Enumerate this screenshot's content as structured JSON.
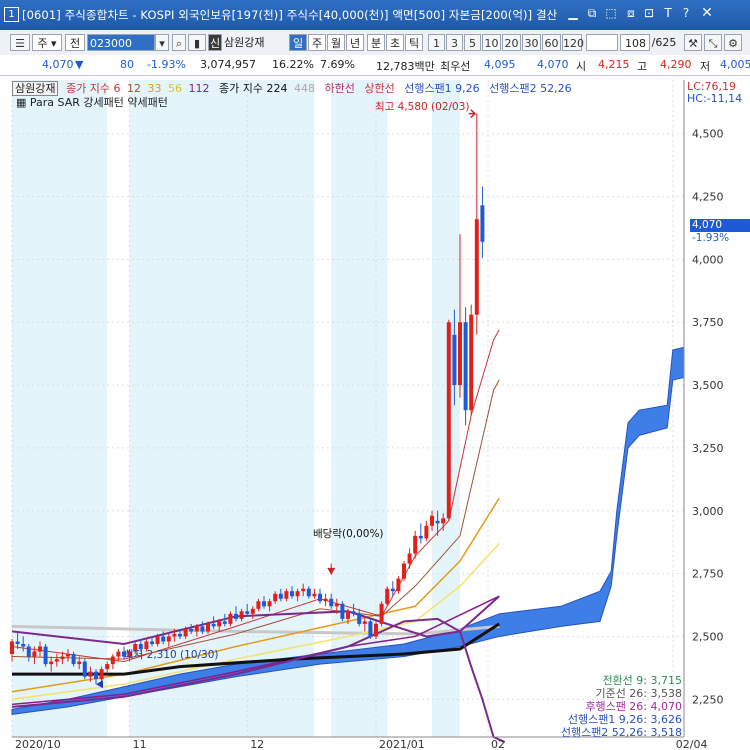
{
  "window": {
    "number": "1",
    "title": "[0601] 주식종합차트 - KOSPI 외국인보유[197(천)] 주식수[40,000(천)] 액면[500] 자본금[200(억)] 결산",
    "controls": [
      "min-icon",
      "restore-icon",
      "max-icon",
      "settings-icon",
      "lock-icon",
      "text-icon",
      "help-icon",
      "close-icon"
    ]
  },
  "toolbar": {
    "market": "주",
    "jeon": "전",
    "code": "023000",
    "badge": "신",
    "stock_name": "삼원강재",
    "periods": [
      "일",
      "주",
      "월",
      "년",
      "분",
      "초",
      "틱"
    ],
    "active_period": "일",
    "intervals": [
      "1",
      "3",
      "5",
      "10",
      "20",
      "30",
      "60",
      "120"
    ],
    "count": "108",
    "total": "/625"
  },
  "info": {
    "price": "4,070",
    "dir": "▼",
    "change": "80",
    "change_pct": "-1.93%",
    "volume": "3,074,957",
    "vol_pct": "16.22%",
    "turnover": "7.69%",
    "amount": "12,783백만",
    "best_ask_label": "최우선",
    "best_ask": "4,095",
    "best_bid": "4,070",
    "open_label": "시",
    "open": "4,215",
    "high_label": "고",
    "high": "4,290",
    "low_label": "저",
    "low": "4,005"
  },
  "legend": {
    "stock": "삼원강재",
    "ma_label": "종가 지수",
    "ma_periods": [
      "6",
      "12",
      "33",
      "56",
      "112"
    ],
    "vol_label": "종가 지수",
    "vol_periods": [
      "224",
      "448"
    ],
    "low_limit": "하한선",
    "high_limit": "상한선",
    "span1": "선행스팬1 9,26",
    "span2": "선행스팬2 52,26",
    "sar": "Para SAR 강세패턴  약세패턴",
    "lc": "LC:76,19",
    "hc": "HC:-11,14"
  },
  "annotations": {
    "high": "최고 4,580 (02/03)",
    "dividend": "배당락(0,00%)",
    "low": "최저 2,310 (10/30)",
    "current_price": "4,070",
    "current_pct": "-1.93%"
  },
  "ichimoku": [
    {
      "text": "전환선 9: 3,715",
      "color": "#2e8b57"
    },
    {
      "text": "기준선 26: 3,538",
      "color": "#555555"
    },
    {
      "text": "후행스팬 26: 4,070",
      "color": "#9b2d9b"
    },
    {
      "text": "선행스팬1 9,26: 3,626",
      "color": "#2a52be"
    },
    {
      "text": "선행스팬2 52,26: 3,518",
      "color": "#2a52be"
    }
  ],
  "chart_data": {
    "type": "candlestick",
    "ylim": [
      2100,
      4650
    ],
    "y_ticks": [
      2250,
      2500,
      2750,
      3000,
      3250,
      3500,
      3750,
      4000,
      4250,
      4500
    ],
    "x_labels": [
      {
        "label": "2020/10",
        "index": 0
      },
      {
        "label": "11",
        "index": 21
      },
      {
        "label": "12",
        "index": 42
      },
      {
        "label": "2021/01",
        "index": 65
      },
      {
        "label": "02",
        "index": 85
      },
      {
        "label": "02/04",
        "index": 118
      }
    ],
    "candles": [
      [
        2430,
        2490,
        2400,
        2480
      ],
      [
        2480,
        2520,
        2450,
        2470
      ],
      [
        2470,
        2500,
        2440,
        2460
      ],
      [
        2460,
        2470,
        2400,
        2420
      ],
      [
        2420,
        2460,
        2390,
        2440
      ],
      [
        2440,
        2480,
        2420,
        2460
      ],
      [
        2460,
        2470,
        2380,
        2390
      ],
      [
        2390,
        2420,
        2360,
        2400
      ],
      [
        2400,
        2430,
        2380,
        2410
      ],
      [
        2410,
        2440,
        2390,
        2420
      ],
      [
        2420,
        2450,
        2400,
        2430
      ],
      [
        2430,
        2440,
        2380,
        2390
      ],
      [
        2390,
        2420,
        2370,
        2400
      ],
      [
        2400,
        2410,
        2330,
        2340
      ],
      [
        2340,
        2380,
        2320,
        2360
      ],
      [
        2360,
        2370,
        2310,
        2330
      ],
      [
        2330,
        2380,
        2320,
        2370
      ],
      [
        2370,
        2400,
        2350,
        2390
      ],
      [
        2390,
        2430,
        2370,
        2420
      ],
      [
        2420,
        2450,
        2400,
        2440
      ],
      [
        2440,
        2460,
        2410,
        2420
      ],
      [
        2420,
        2450,
        2400,
        2440
      ],
      [
        2440,
        2480,
        2430,
        2470
      ],
      [
        2470,
        2490,
        2440,
        2450
      ],
      [
        2450,
        2490,
        2440,
        2480
      ],
      [
        2480,
        2500,
        2460,
        2470
      ],
      [
        2470,
        2510,
        2460,
        2500
      ],
      [
        2500,
        2520,
        2470,
        2480
      ],
      [
        2480,
        2510,
        2460,
        2500
      ],
      [
        2500,
        2530,
        2480,
        2510
      ],
      [
        2510,
        2530,
        2490,
        2500
      ],
      [
        2500,
        2540,
        2490,
        2530
      ],
      [
        2530,
        2550,
        2510,
        2520
      ],
      [
        2520,
        2550,
        2500,
        2540
      ],
      [
        2540,
        2560,
        2510,
        2520
      ],
      [
        2520,
        2560,
        2510,
        2550
      ],
      [
        2550,
        2580,
        2530,
        2540
      ],
      [
        2540,
        2570,
        2520,
        2560
      ],
      [
        2560,
        2590,
        2540,
        2550
      ],
      [
        2550,
        2600,
        2540,
        2590
      ],
      [
        2590,
        2620,
        2560,
        2570
      ],
      [
        2570,
        2610,
        2560,
        2600
      ],
      [
        2600,
        2630,
        2580,
        2590
      ],
      [
        2590,
        2620,
        2570,
        2610
      ],
      [
        2610,
        2650,
        2600,
        2640
      ],
      [
        2640,
        2660,
        2610,
        2620
      ],
      [
        2620,
        2650,
        2600,
        2640
      ],
      [
        2640,
        2680,
        2630,
        2670
      ],
      [
        2670,
        2690,
        2640,
        2650
      ],
      [
        2650,
        2690,
        2640,
        2680
      ],
      [
        2680,
        2700,
        2650,
        2660
      ],
      [
        2660,
        2690,
        2640,
        2680
      ],
      [
        2680,
        2710,
        2660,
        2690
      ],
      [
        2690,
        2700,
        2650,
        2660
      ],
      [
        2660,
        2690,
        2650,
        2670
      ],
      [
        2670,
        2690,
        2630,
        2640
      ],
      [
        2640,
        2670,
        2620,
        2650
      ],
      [
        2650,
        2670,
        2610,
        2620
      ],
      [
        2620,
        2650,
        2590,
        2630
      ],
      [
        2630,
        2640,
        2560,
        2570
      ],
      [
        2570,
        2610,
        2550,
        2600
      ],
      [
        2600,
        2630,
        2580,
        2590
      ],
      [
        2590,
        2610,
        2540,
        2550
      ],
      [
        2550,
        2580,
        2520,
        2560
      ],
      [
        2560,
        2570,
        2490,
        2500
      ],
      [
        2500,
        2560,
        2490,
        2550
      ],
      [
        2550,
        2640,
        2540,
        2630
      ],
      [
        2630,
        2700,
        2620,
        2690
      ],
      [
        2690,
        2720,
        2660,
        2680
      ],
      [
        2680,
        2740,
        2670,
        2730
      ],
      [
        2730,
        2800,
        2720,
        2790
      ],
      [
        2790,
        2850,
        2770,
        2830
      ],
      [
        2830,
        2920,
        2810,
        2900
      ],
      [
        2900,
        2950,
        2870,
        2890
      ],
      [
        2890,
        2960,
        2880,
        2940
      ],
      [
        2940,
        3000,
        2920,
        2980
      ],
      [
        2960,
        3000,
        2900,
        2950
      ],
      [
        2950,
        2990,
        2920,
        2970
      ],
      [
        2970,
        3760,
        2960,
        3750
      ],
      [
        3700,
        3800,
        3420,
        3500
      ],
      [
        3500,
        4100,
        3450,
        3750
      ],
      [
        3750,
        3810,
        3340,
        3400
      ],
      [
        3400,
        3820,
        3380,
        3780
      ],
      [
        3780,
        4580,
        3700,
        4160
      ],
      [
        4215,
        4290,
        4005,
        4070
      ]
    ],
    "x_index_max": 120,
    "ma_short": [
      [
        0,
        2460
      ],
      [
        20,
        2400
      ],
      [
        40,
        2540
      ],
      [
        55,
        2650
      ],
      [
        66,
        2580
      ],
      [
        72,
        2820
      ],
      [
        78,
        2960
      ],
      [
        82,
        3380
      ],
      [
        86,
        3680
      ],
      [
        87,
        3720
      ]
    ],
    "ma_mid": [
      [
        0,
        2420
      ],
      [
        20,
        2410
      ],
      [
        40,
        2510
      ],
      [
        55,
        2610
      ],
      [
        66,
        2580
      ],
      [
        72,
        2700
      ],
      [
        80,
        2900
      ],
      [
        86,
        3480
      ],
      [
        87,
        3520
      ]
    ],
    "ma_33": [
      [
        0,
        2280
      ],
      [
        20,
        2350
      ],
      [
        40,
        2460
      ],
      [
        60,
        2560
      ],
      [
        72,
        2620
      ],
      [
        80,
        2800
      ],
      [
        87,
        3050
      ]
    ],
    "ma_56": [
      [
        0,
        2250
      ],
      [
        20,
        2310
      ],
      [
        40,
        2410
      ],
      [
        60,
        2500
      ],
      [
        72,
        2560
      ],
      [
        80,
        2700
      ],
      [
        87,
        2870
      ]
    ],
    "ma_112": [
      [
        0,
        2230
      ],
      [
        20,
        2270
      ],
      [
        40,
        2360
      ],
      [
        60,
        2460
      ],
      [
        72,
        2500
      ],
      [
        87,
        2660
      ]
    ],
    "ma_224": [
      [
        0,
        2540
      ],
      [
        40,
        2520
      ],
      [
        72,
        2510
      ],
      [
        87,
        2540
      ]
    ],
    "base_line": [
      [
        0,
        2350
      ],
      [
        20,
        2350
      ],
      [
        30,
        2380
      ],
      [
        50,
        2410
      ],
      [
        70,
        2430
      ],
      [
        80,
        2450
      ],
      [
        87,
        2550
      ]
    ],
    "kumo_top": [
      [
        0,
        2210
      ],
      [
        10,
        2250
      ],
      [
        20,
        2300
      ],
      [
        30,
        2350
      ],
      [
        40,
        2390
      ],
      [
        55,
        2430
      ],
      [
        70,
        2470
      ],
      [
        80,
        2530
      ],
      [
        87,
        2590
      ],
      [
        98,
        2620
      ],
      [
        105,
        2680
      ],
      [
        107,
        2760
      ],
      [
        108,
        3000
      ],
      [
        110,
        3350
      ],
      [
        112,
        3400
      ],
      [
        117,
        3420
      ],
      [
        118,
        3640
      ],
      [
        120,
        3650
      ]
    ],
    "kumo_bot": [
      [
        0,
        2190
      ],
      [
        10,
        2220
      ],
      [
        20,
        2260
      ],
      [
        30,
        2300
      ],
      [
        40,
        2340
      ],
      [
        55,
        2390
      ],
      [
        70,
        2420
      ],
      [
        80,
        2460
      ],
      [
        87,
        2500
      ],
      [
        98,
        2540
      ],
      [
        105,
        2560
      ],
      [
        107,
        2700
      ],
      [
        108,
        2900
      ],
      [
        110,
        3250
      ],
      [
        112,
        3300
      ],
      [
        117,
        3330
      ],
      [
        118,
        3520
      ],
      [
        120,
        3530
      ]
    ],
    "chikou": [
      [
        0,
        2220
      ],
      [
        20,
        2260
      ],
      [
        40,
        2350
      ],
      [
        60,
        2460
      ],
      [
        70,
        2560
      ],
      [
        76,
        2570
      ],
      [
        80,
        2520
      ],
      [
        82,
        2380
      ],
      [
        84,
        2250
      ],
      [
        86,
        2100
      ],
      [
        88,
        2080
      ]
    ],
    "sar_purple_upper": [
      [
        0,
        2520
      ],
      [
        20,
        2470
      ],
      [
        40,
        2580
      ],
      [
        60,
        2600
      ],
      [
        74,
        2500
      ],
      [
        80,
        2520
      ],
      [
        87,
        2660
      ]
    ]
  }
}
